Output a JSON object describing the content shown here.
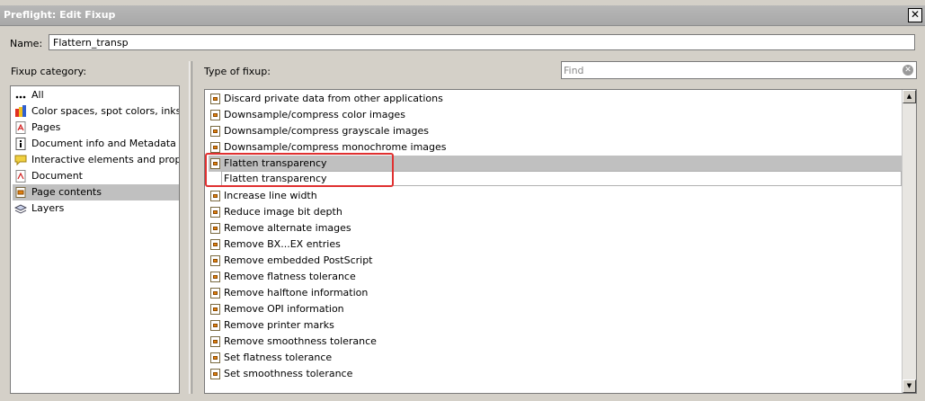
{
  "window": {
    "title": "Preflight: Edit Fixup",
    "close_glyph": "✕"
  },
  "name_field": {
    "label": "Name:",
    "value": "Flattern_transp"
  },
  "fixup_category": {
    "label": "Fixup category:",
    "items": [
      {
        "label": "All",
        "icon": "dots-icon"
      },
      {
        "label": "Color spaces, spot colors, inks",
        "icon": "color-icon"
      },
      {
        "label": "Pages",
        "icon": "pdf-page-icon"
      },
      {
        "label": "Document info and Metadata",
        "icon": "info-icon"
      },
      {
        "label": "Interactive elements and properties",
        "icon": "comment-icon"
      },
      {
        "label": "Document",
        "icon": "pdf-document-icon"
      },
      {
        "label": "Page contents",
        "icon": "page-contents-icon",
        "selected": true
      },
      {
        "label": "Layers",
        "icon": "layers-icon"
      }
    ]
  },
  "type_of_fixup": {
    "label": "Type of fixup:",
    "find_placeholder": "Find",
    "items": [
      "Discard private data from other applications",
      "Downsample/compress color images",
      "Downsample/compress grayscale images",
      "Downsample/compress monochrome images",
      "Flatten transparency",
      "Increase line width",
      "Reduce image bit depth",
      "Remove alternate images",
      "Remove BX...EX entries",
      "Remove embedded PostScript",
      "Remove flatness tolerance",
      "Remove halftone information",
      "Remove OPI information",
      "Remove printer marks",
      "Remove smoothness tolerance",
      "Set flatness tolerance",
      "Set smoothness tolerance"
    ],
    "selected_index": 4,
    "tooltip": "Flatten transparency"
  },
  "colors": {
    "highlight": "#e03030",
    "selection": "#c0c0c0"
  }
}
